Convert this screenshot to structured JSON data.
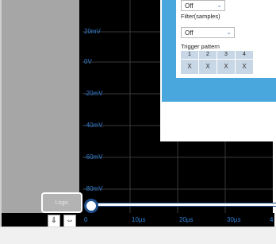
{
  "waveform": {
    "y_labels": [
      "20mV",
      "0V",
      "-20mV",
      "-40mV",
      "-60mV",
      "-80mV"
    ],
    "x_labels": [
      "0",
      "10µs",
      "20µs",
      "30µs",
      "4"
    ]
  },
  "settings_popup": {
    "top_dropdown_value": "Off",
    "filter_label": "Filter(samples)",
    "filter_value": "Off",
    "trigger_pattern_label": "Trigger pattern",
    "trigger_columns": [
      "1",
      "2",
      "3",
      "4"
    ],
    "trigger_values": [
      "X",
      "X",
      "X",
      "X"
    ]
  },
  "logic_button": {
    "label": "Logic"
  },
  "mini_buttons": {
    "down_icon": "arrow-down",
    "horizontal_icon": "arrows-horizontal"
  },
  "colors": {
    "accent": "#4aa7dd",
    "label_blue": "#2f7fd6",
    "callout": "#1f4f8c"
  }
}
